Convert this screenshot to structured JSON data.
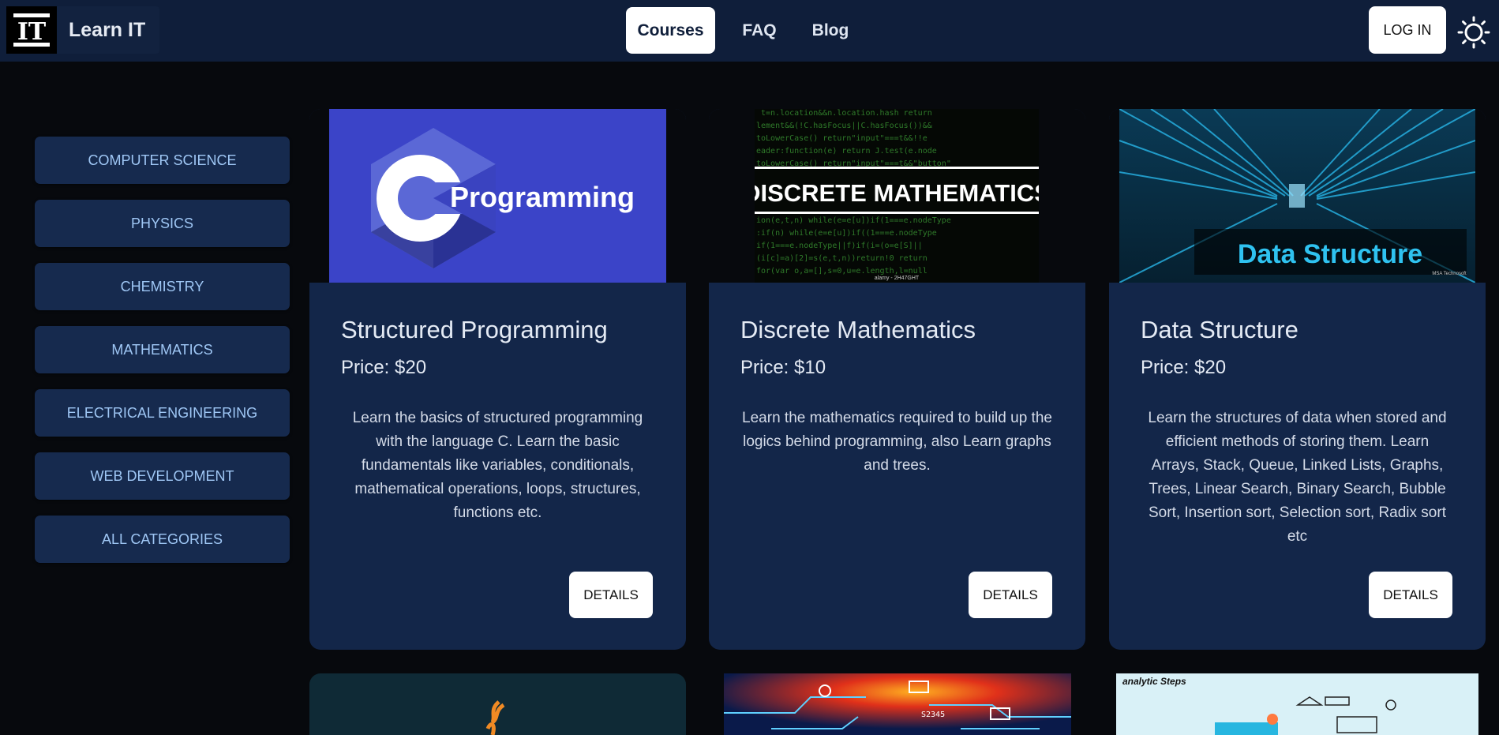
{
  "brand": {
    "logo_text": "IT",
    "name": "Learn IT"
  },
  "nav": {
    "links": [
      {
        "label": "Courses",
        "active": true
      },
      {
        "label": "FAQ",
        "active": false
      },
      {
        "label": "Blog",
        "active": false
      }
    ],
    "login_label": "LOG IN"
  },
  "categories": [
    "COMPUTER SCIENCE",
    "PHYSICS",
    "CHEMISTRY",
    "MATHEMATICS",
    "ELECTRICAL ENGINEERING",
    "WEB DEVELOPMENT",
    "ALL CATEGORIES"
  ],
  "courses": [
    {
      "image_text": "Programming",
      "title": "Structured Programming",
      "price": "Price: $20",
      "description": "Learn the basics of structured programming with the language C. Learn the basic fundamentals like variables, conditionals, mathematical operations, loops, structures, functions etc.",
      "details_label": "DETAILS"
    },
    {
      "image_text": "DISCRETE MATHEMATICS",
      "image_caption": "alamy - 2H47GHT",
      "title": "Discrete Mathematics",
      "price": "Price: $10",
      "description": "Learn the mathematics required to build up the logics behind programming, also Learn graphs and trees.",
      "details_label": "DETAILS"
    },
    {
      "image_text": "Data Structure",
      "image_caption": "MSA Technosoft",
      "title": "Data Structure",
      "price": "Price: $20",
      "description": "Learn the structures of data when stored and efficient methods of storing them. Learn Arrays, Stack, Queue, Linked Lists, Graphs, Trees, Linear Search, Binary Search, Bubble Sort, Insertion sort, Selection sort, Radix sort etc",
      "details_label": "DETAILS"
    }
  ],
  "second_row_labels": {
    "card3_brand": "analytic Steps",
    "circuit_text": "S2345"
  },
  "colors": {
    "navbar": "#0f1e3a",
    "card": "#132649",
    "category_button": "#162a4e",
    "category_text": "#9fc7f5",
    "page_bg": "#07090d"
  }
}
